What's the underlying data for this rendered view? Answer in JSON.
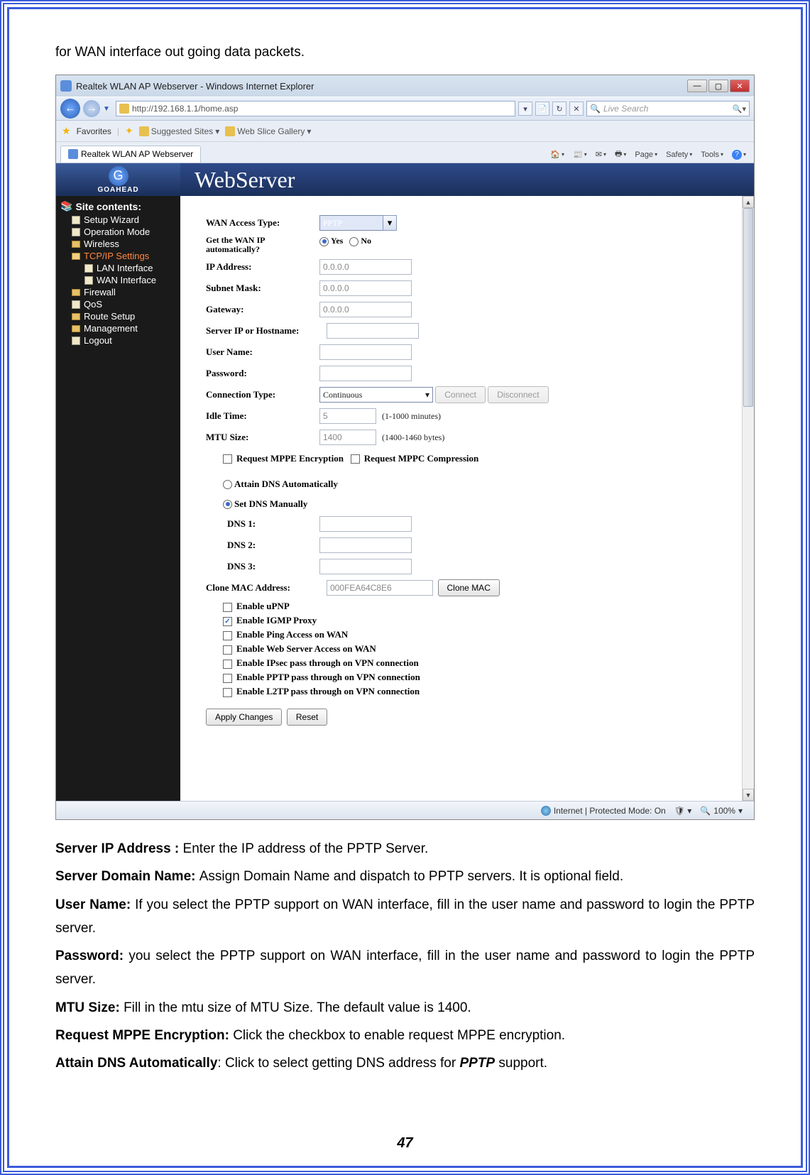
{
  "intro": "for WAN interface out going data packets.",
  "window": {
    "title": "Realtek WLAN AP Webserver - Windows Internet Explorer",
    "url": "http://192.168.1.1/home.asp",
    "search_placeholder": "Live Search",
    "fav_label": "Favorites",
    "fav_links": [
      "Suggested Sites",
      "Web Slice Gallery"
    ],
    "tab_title": "Realtek WLAN AP Webserver",
    "menus": [
      "Page",
      "Safety",
      "Tools"
    ]
  },
  "brand": {
    "logo_text": "GOAHEAD",
    "banner": "WebServer"
  },
  "tree": {
    "root": "Site contents:",
    "items": [
      {
        "label": "Setup Wizard",
        "type": "doc"
      },
      {
        "label": "Operation Mode",
        "type": "doc"
      },
      {
        "label": "Wireless",
        "type": "fold"
      },
      {
        "label": "TCP/IP Settings",
        "type": "fold-open",
        "active": true
      },
      {
        "label": "LAN Interface",
        "type": "doc",
        "nested": true
      },
      {
        "label": "WAN Interface",
        "type": "doc",
        "nested": true
      },
      {
        "label": "Firewall",
        "type": "fold"
      },
      {
        "label": "QoS",
        "type": "doc"
      },
      {
        "label": "Route Setup",
        "type": "fold"
      },
      {
        "label": "Management",
        "type": "fold"
      },
      {
        "label": "Logout",
        "type": "doc"
      }
    ]
  },
  "form": {
    "wan_access_type": {
      "label": "WAN Access Type:",
      "value": "PPTP"
    },
    "get_wan_ip": {
      "label": "Get the WAN IP automatically?",
      "yes": "Yes",
      "no": "No",
      "selected": "yes"
    },
    "ip_address": {
      "label": "IP Address:",
      "value": "0.0.0.0"
    },
    "subnet": {
      "label": "Subnet Mask:",
      "value": "0.0.0.0"
    },
    "gateway": {
      "label": "Gateway:",
      "value": "0.0.0.0"
    },
    "server_ip": {
      "label": "Server IP or Hostname:",
      "value": ""
    },
    "user_name": {
      "label": "User Name:",
      "value": ""
    },
    "password": {
      "label": "Password:",
      "value": ""
    },
    "conn_type": {
      "label": "Connection Type:",
      "value": "Continuous"
    },
    "connect": "Connect",
    "disconnect": "Disconnect",
    "idle": {
      "label": "Idle Time:",
      "value": "5",
      "hint": "(1-1000 minutes)"
    },
    "mtu": {
      "label": "MTU Size:",
      "value": "1400",
      "hint": "(1400-1460 bytes)"
    },
    "mppe": "Request MPPE Encryption",
    "mppc": "Request MPPC Compression",
    "dns_auto": "Attain DNS Automatically",
    "dns_manual": "Set DNS Manually",
    "dns1": "DNS 1:",
    "dns2": "DNS 2:",
    "dns3": "DNS 3:",
    "clone_mac": {
      "label": "Clone MAC Address:",
      "value": "000FEA64C8E6",
      "btn": "Clone MAC"
    },
    "cbs": [
      {
        "label": "Enable uPNP",
        "checked": false
      },
      {
        "label": "Enable IGMP Proxy",
        "checked": true
      },
      {
        "label": "Enable Ping Access on WAN",
        "checked": false
      },
      {
        "label": "Enable Web Server Access on WAN",
        "checked": false
      },
      {
        "label": "Enable IPsec pass through on VPN connection",
        "checked": false
      },
      {
        "label": "Enable PPTP pass through on VPN connection",
        "checked": false
      },
      {
        "label": "Enable L2TP pass through on VPN connection",
        "checked": false
      }
    ],
    "apply": "Apply Changes",
    "reset": "Reset"
  },
  "status": {
    "zone": "Internet | Protected Mode: On",
    "zoom": "100%"
  },
  "desc": {
    "p1a": "Server IP Address : ",
    "p1b": "Enter the IP address of the PPTP Server.",
    "p2a": "Server Domain Name: ",
    "p2b": "Assign Domain Name and dispatch to PPTP servers. It is optional field.",
    "p3a": "User Name: ",
    "p3b": "If you select the PPTP support on WAN interface, fill in the user name and password to login the PPTP server.",
    "p4a": "Password: ",
    "p4b": "you select the PPTP support on WAN interface, fill in the user name and password to login the PPTP server.",
    "p5a": "MTU Size: ",
    "p5b": "Fill in the mtu size of MTU Size. The default value is 1400.",
    "p6a": "Request MPPE Encryption: ",
    "p6b": "Click the checkbox to enable request MPPE encryption.",
    "p7a": "Attain DNS Automatically",
    "p7b": ": Click to select getting DNS address for ",
    "p7c": "PPTP",
    "p7d": " support."
  },
  "page_number": "47"
}
